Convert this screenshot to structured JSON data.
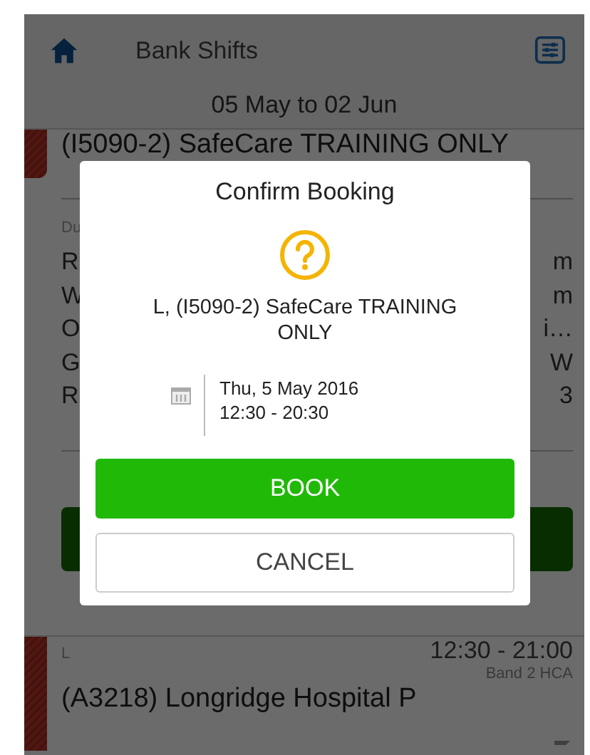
{
  "header": {
    "title": "Bank Shifts",
    "date_range": "05 May to 02 Jun"
  },
  "shift_card": {
    "title": "(I5090-2) SafeCare TRAINING ONLY",
    "section_label": "Du",
    "details": [
      {
        "label": "R",
        "value": "m"
      },
      {
        "label": "W",
        "value": "m"
      },
      {
        "label": "O",
        "value": "i…"
      },
      {
        "label": "G",
        "value": "W"
      },
      {
        "label": "R",
        "value": "3"
      }
    ]
  },
  "next_shift": {
    "code": "L",
    "time": "12:30 - 21:00",
    "grade": "Band 2 HCA",
    "title": "(A3218) Longridge Hospital P"
  },
  "dialog": {
    "title": "Confirm Booking",
    "message": "L, (I5090-2) SafeCare TRAINING ONLY",
    "date": "Thu, 5 May 2016",
    "time": "12:30 - 20:30",
    "buttons": [
      {
        "label": "BOOK",
        "kind": "primary"
      },
      {
        "label": "CANCEL",
        "kind": "secondary"
      }
    ]
  }
}
